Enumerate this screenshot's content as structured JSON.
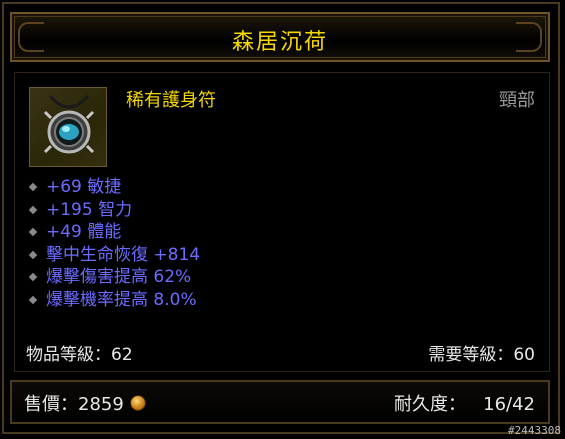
{
  "item": {
    "name": "森居沉荷",
    "type": "稀有護身符",
    "slot": "頸部",
    "stats": [
      "+69 敏捷",
      "+195 智力",
      "+49 體能",
      "擊中生命恢復 +814",
      "爆擊傷害提高 62%",
      "爆擊機率提高 8.0%"
    ],
    "item_level": "物品等級：62",
    "required_level": "需要等級：60",
    "sell_label": "售價：",
    "sell_value": "2859",
    "durability_label": "耐久度：",
    "durability_value": "16/42"
  },
  "watermark": "#2443308",
  "colors": {
    "title": "#f7d800",
    "affix": "#6b6bff",
    "border": "#6b5428"
  },
  "icons": [
    "amulet-icon",
    "bullet-diamond-icon",
    "gold-coin-icon"
  ]
}
